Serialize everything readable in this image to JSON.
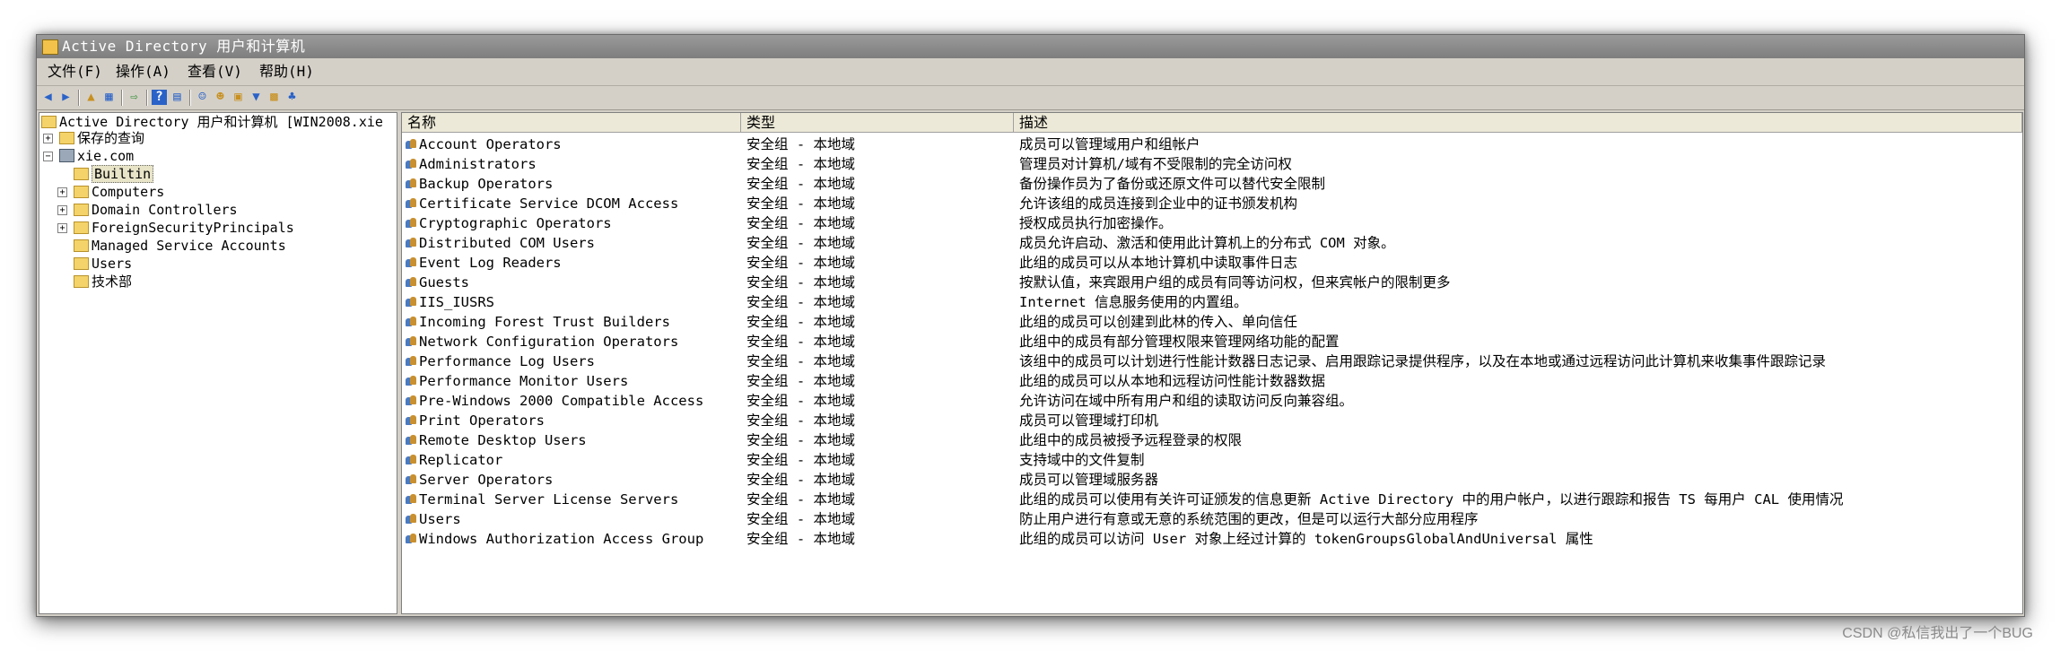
{
  "window": {
    "title": "Active Directory 用户和计算机"
  },
  "menu": [
    "文件(F)",
    "操作(A)",
    "查看(V)",
    "帮助(H)"
  ],
  "toolbar": [
    "back-icon",
    "forward-icon",
    "up-icon",
    "show-hide-tree-icon",
    "export-icon",
    "help-icon",
    "properties-icon",
    "new-user-icon",
    "new-group-icon",
    "new-ou-icon",
    "filter-icon",
    "find-icon",
    "add-to-group-icon"
  ],
  "tree": {
    "root": "Active Directory 用户和计算机 [WIN2008.xie",
    "saved_queries": "保存的查询",
    "domain": "xie.com",
    "children": [
      "Builtin",
      "Computers",
      "Domain Controllers",
      "ForeignSecurityPrincipals",
      "Managed Service Accounts",
      "Users",
      "技术部"
    ]
  },
  "columns": [
    "名称",
    "类型",
    "描述"
  ],
  "rows": [
    {
      "name": "Account Operators",
      "type": "安全组 - 本地域",
      "desc": "成员可以管理域用户和组帐户"
    },
    {
      "name": "Administrators",
      "type": "安全组 - 本地域",
      "desc": "管理员对计算机/域有不受限制的完全访问权"
    },
    {
      "name": "Backup Operators",
      "type": "安全组 - 本地域",
      "desc": "备份操作员为了备份或还原文件可以替代安全限制"
    },
    {
      "name": "Certificate Service DCOM Access",
      "type": "安全组 - 本地域",
      "desc": "允许该组的成员连接到企业中的证书颁发机构"
    },
    {
      "name": "Cryptographic Operators",
      "type": "安全组 - 本地域",
      "desc": "授权成员执行加密操作。"
    },
    {
      "name": "Distributed COM Users",
      "type": "安全组 - 本地域",
      "desc": "成员允许启动、激活和使用此计算机上的分布式 COM 对象。"
    },
    {
      "name": "Event Log Readers",
      "type": "安全组 - 本地域",
      "desc": "此组的成员可以从本地计算机中读取事件日志"
    },
    {
      "name": "Guests",
      "type": "安全组 - 本地域",
      "desc": "按默认值，来宾跟用户组的成员有同等访问权，但来宾帐户的限制更多"
    },
    {
      "name": "IIS_IUSRS",
      "type": "安全组 - 本地域",
      "desc": "Internet 信息服务使用的内置组。"
    },
    {
      "name": "Incoming Forest Trust Builders",
      "type": "安全组 - 本地域",
      "desc": "此组的成员可以创建到此林的传入、单向信任"
    },
    {
      "name": "Network Configuration Operators",
      "type": "安全组 - 本地域",
      "desc": "此组中的成员有部分管理权限来管理网络功能的配置"
    },
    {
      "name": "Performance Log Users",
      "type": "安全组 - 本地域",
      "desc": "该组中的成员可以计划进行性能计数器日志记录、启用跟踪记录提供程序，以及在本地或通过远程访问此计算机来收集事件跟踪记录"
    },
    {
      "name": "Performance Monitor Users",
      "type": "安全组 - 本地域",
      "desc": "此组的成员可以从本地和远程访问性能计数器数据"
    },
    {
      "name": "Pre-Windows 2000 Compatible Access",
      "type": "安全组 - 本地域",
      "desc": "允许访问在域中所有用户和组的读取访问反向兼容组。"
    },
    {
      "name": "Print Operators",
      "type": "安全组 - 本地域",
      "desc": "成员可以管理域打印机"
    },
    {
      "name": "Remote Desktop Users",
      "type": "安全组 - 本地域",
      "desc": "此组中的成员被授予远程登录的权限"
    },
    {
      "name": "Replicator",
      "type": "安全组 - 本地域",
      "desc": "支持域中的文件复制"
    },
    {
      "name": "Server Operators",
      "type": "安全组 - 本地域",
      "desc": "成员可以管理域服务器"
    },
    {
      "name": "Terminal Server License Servers",
      "type": "安全组 - 本地域",
      "desc": "此组的成员可以使用有关许可证颁发的信息更新 Active Directory 中的用户帐户，以进行跟踪和报告 TS 每用户 CAL 使用情况"
    },
    {
      "name": "Users",
      "type": "安全组 - 本地域",
      "desc": "防止用户进行有意或无意的系统范围的更改，但是可以运行大部分应用程序"
    },
    {
      "name": "Windows Authorization Access Group",
      "type": "安全组 - 本地域",
      "desc": "此组的成员可以访问 User 对象上经过计算的 tokenGroupsGlobalAndUniversal 属性"
    }
  ],
  "watermark": "CSDN @私信我出了一个BUG"
}
